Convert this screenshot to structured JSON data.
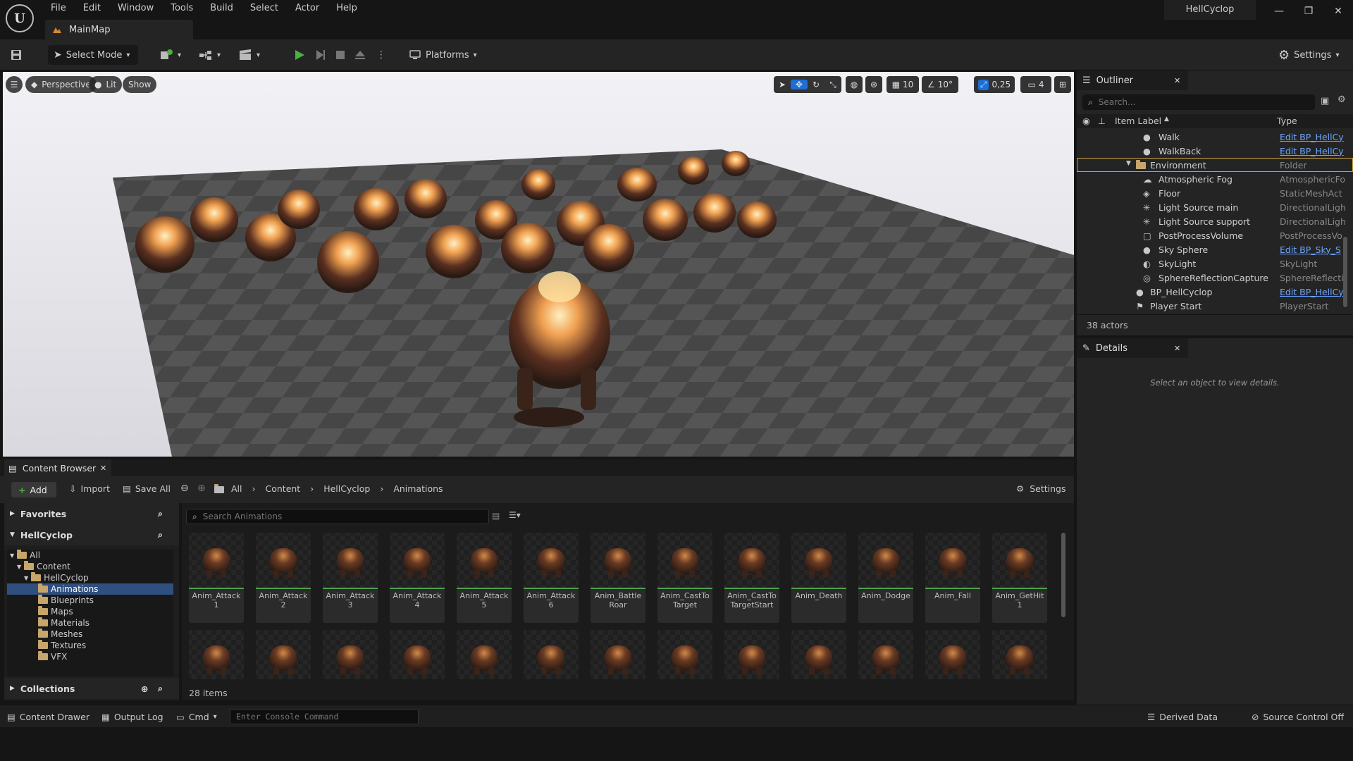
{
  "app": {
    "project_name": "HellCyclop",
    "map_tab": "MainMap",
    "menu": [
      "File",
      "Edit",
      "Window",
      "Tools",
      "Build",
      "Select",
      "Actor",
      "Help"
    ]
  },
  "toolbar": {
    "select_mode": "Select Mode",
    "platforms": "Platforms",
    "settings": "Settings"
  },
  "viewport": {
    "perspective": "Perspective",
    "lit": "Lit",
    "show": "Show",
    "grid_snap": "10",
    "rotation_snap": "10°",
    "scale_snap": "0,25",
    "camera_speed": "4"
  },
  "outliner": {
    "tab": "Outliner",
    "search_placeholder": "Search...",
    "col_label": "Item Label",
    "col_type": "Type",
    "rows": [
      {
        "label": "Walk",
        "type": "Edit BP_HellCy",
        "link": true
      },
      {
        "label": "WalkBack",
        "type": "Edit BP_HellCy",
        "link": true
      },
      {
        "label": "Environment",
        "type": "Folder",
        "link": false
      },
      {
        "label": "Atmospheric Fog",
        "type": "AtmosphericFo",
        "link": false
      },
      {
        "label": "Floor",
        "type": "StaticMeshAct",
        "link": false
      },
      {
        "label": "Light Source main",
        "type": "DirectionalLigh",
        "link": false
      },
      {
        "label": "Light Source support",
        "type": "DirectionalLigh",
        "link": false
      },
      {
        "label": "PostProcessVolume",
        "type": "PostProcessVo",
        "link": false
      },
      {
        "label": "Sky Sphere",
        "type": "Edit BP_Sky_S",
        "link": true
      },
      {
        "label": "SkyLight",
        "type": "SkyLight",
        "link": false
      },
      {
        "label": "SphereReflectionCapture",
        "type": "SphereReflecti",
        "link": false
      },
      {
        "label": "BP_HellCyclop",
        "type": "Edit BP_HellCy",
        "link": true
      },
      {
        "label": "Player Start",
        "type": "PlayerStart",
        "link": false
      }
    ],
    "actor_count": "38 actors"
  },
  "details": {
    "tab": "Details",
    "empty_message": "Select an object to view details."
  },
  "content_browser": {
    "tab": "Content Browser",
    "add": "Add",
    "import": "Import",
    "save_all": "Save All",
    "breadcrumb": [
      "All",
      "Content",
      "HellCyclop",
      "Animations"
    ],
    "settings": "Settings",
    "favorites": "Favorites",
    "project_section": "HellCyclop",
    "collections": "Collections",
    "search_placeholder": "Search Animations",
    "tree": [
      "All",
      "Content",
      "HellCyclop",
      "Animations",
      "Blueprints",
      "Maps",
      "Materials",
      "Meshes",
      "Textures",
      "VFX"
    ],
    "assets": [
      "Anim_Attack1",
      "Anim_Attack2",
      "Anim_Attack3",
      "Anim_Attack4",
      "Anim_Attack5",
      "Anim_Attack6",
      "Anim_Battle Roar",
      "Anim_CastTo Target",
      "Anim_CastTo TargetStart",
      "Anim_Death",
      "Anim_Dodge",
      "Anim_Fall",
      "Anim_GetHit1"
    ],
    "item_count": "28 items"
  },
  "statusbar": {
    "content_drawer": "Content Drawer",
    "output_log": "Output Log",
    "cmd": "Cmd",
    "console_placeholder": "Enter Console Command",
    "derived_data": "Derived Data",
    "source_control": "Source Control Off"
  },
  "colors": {
    "accent_blue": "#1a6fd8",
    "play_green": "#4caf3f",
    "link_blue": "#6ea4ff",
    "selection": "#2f4f7f"
  }
}
